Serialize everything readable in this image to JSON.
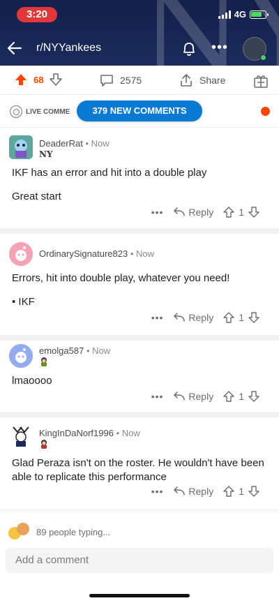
{
  "status_bar": {
    "time": "3:20",
    "network": "4G"
  },
  "nav": {
    "subreddit": "r/NYYankees"
  },
  "post_actions": {
    "vote_count": "68",
    "comment_count": "2575",
    "share_label": "Share"
  },
  "live": {
    "label": "LIVE COMME",
    "new_comments": "379 NEW COMMENTS"
  },
  "comments": [
    {
      "author": "DeaderRat",
      "time": "Now",
      "flair": "NY",
      "paragraphs": [
        "IKF has an error and hit into a double play",
        "Great start"
      ],
      "votes": "1",
      "reply_label": "Reply"
    },
    {
      "author": "OrdinarySignature823",
      "time": "Now",
      "flair": "",
      "paragraphs": [
        "Errors, hit into double play, whatever you need!",
        "•  IKF"
      ],
      "votes": "1",
      "reply_label": "Reply"
    },
    {
      "author": "emolga587",
      "time": "Now",
      "flair": "",
      "paragraphs": [
        "lmaoooo"
      ],
      "votes": "1",
      "reply_label": "Reply"
    },
    {
      "author": "KingInDaNorf1996",
      "time": "Now",
      "flair": "",
      "paragraphs": [
        "Glad Peraza isn't on the roster. He wouldn't have been able to replicate this performance"
      ],
      "votes": "1",
      "reply_label": "Reply"
    }
  ],
  "composer": {
    "typing": "89 people typing...",
    "placeholder": "Add a comment"
  },
  "colors": {
    "header": "#1c2b5c",
    "upvote": "#ff4500",
    "pill": "#0a79d3",
    "time_pill": "#e0383a"
  }
}
